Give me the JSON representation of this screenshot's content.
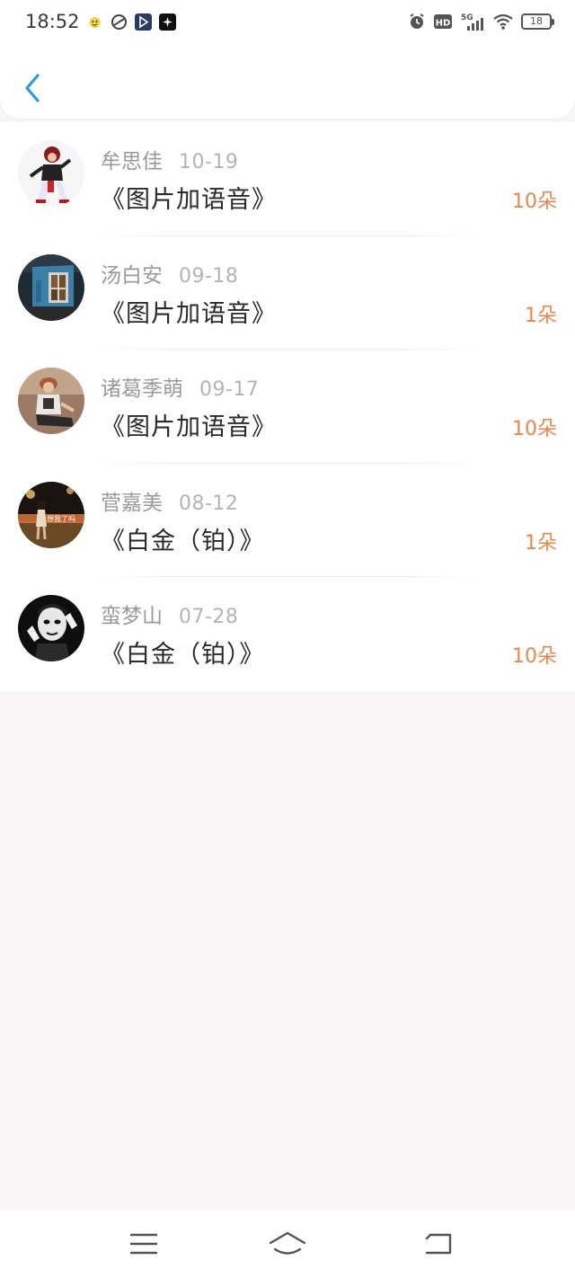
{
  "status_bar": {
    "time": "18:52",
    "notification_icons": [
      "app-icon-1",
      "app-icon-2",
      "app-icon-3",
      "app-icon-4"
    ],
    "network": "5G",
    "hd_label": "HD",
    "battery": "18"
  },
  "header": {
    "back_icon": "chevron-left-icon"
  },
  "records": [
    {
      "name": "牟思佳",
      "date": "10-19",
      "title": "《图片加语音》",
      "amount": "10朵"
    },
    {
      "name": "汤白安",
      "date": "09-18",
      "title": "《图片加语音》",
      "amount": "1朵"
    },
    {
      "name": "诸葛季萌",
      "date": "09-17",
      "title": "《图片加语音》",
      "amount": "10朵"
    },
    {
      "name": "菅嘉美",
      "date": "08-12",
      "title": "《白金（铂）》",
      "amount": "1朵"
    },
    {
      "name": "蛮梦山",
      "date": "07-28",
      "title": "《白金（铂）》",
      "amount": "10朵"
    }
  ],
  "avatar_overlay_text": "想我了吗",
  "nav_bar": {
    "items": [
      "menu-icon",
      "home-icon",
      "back-icon"
    ]
  },
  "colors": {
    "accent_blue": "#2d9be0",
    "amount_orange": "#e8874d",
    "page_background": "#f8f6f7"
  }
}
